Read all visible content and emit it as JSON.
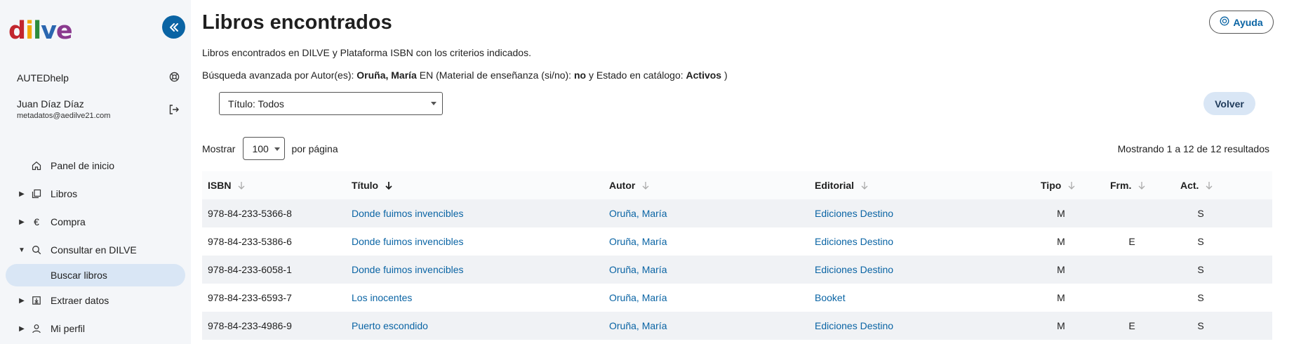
{
  "sidebar": {
    "logo": {
      "d": "d",
      "i": "i",
      "l": "l",
      "v": "v",
      "e": "e"
    },
    "org": "AUTEDhelp",
    "user_name": "Juan Díaz Díaz",
    "user_email": "metadatos@aedilve21.com",
    "nav": [
      {
        "label": "Panel de inicio",
        "icon": "home-icon"
      },
      {
        "label": "Libros",
        "icon": "books-icon",
        "caret": "▶"
      },
      {
        "label": "Compra",
        "icon": "euro-icon",
        "caret": "▶"
      },
      {
        "label": "Consultar en DILVE",
        "icon": "search-icon",
        "caret": "▼"
      },
      {
        "label": "Buscar libros"
      },
      {
        "label": "Extraer datos",
        "icon": "download-icon",
        "caret": "▶"
      },
      {
        "label": "Mi perfil",
        "icon": "user-icon",
        "caret": "▶"
      }
    ]
  },
  "header": {
    "title": "Libros encontrados",
    "help_label": "Ayuda"
  },
  "search": {
    "description": "Libros encontrados en DILVE y Plataforma ISBN con los criterios indicados.",
    "criteria_prefix": "Búsqueda avanzada por Autor(es): ",
    "criteria_author": "Oruña, María",
    "criteria_mid1": " EN (Material de enseñanza (si/no): ",
    "criteria_material": "no",
    "criteria_mid2": " y Estado en catálogo: ",
    "criteria_status": "Activos",
    "criteria_suffix": " )",
    "title_filter": "Título: Todos",
    "back_label": "Volver"
  },
  "pagination": {
    "show_label": "Mostrar",
    "per_page": "100",
    "per_page_suffix": "por página",
    "results_text": "Mostrando 1 a 12 de 12 resultados"
  },
  "table": {
    "columns": [
      "ISBN",
      "Título",
      "Autor",
      "Editorial",
      "Tipo",
      "Frm.",
      "Act."
    ],
    "rows": [
      {
        "isbn": "978-84-233-5366-8",
        "title": "Donde fuimos invencibles",
        "author": "Oruña, María",
        "publisher": "Ediciones Destino",
        "type": "M",
        "frm": "",
        "act": "S"
      },
      {
        "isbn": "978-84-233-5386-6",
        "title": "Donde fuimos invencibles",
        "author": "Oruña, María",
        "publisher": "Ediciones Destino",
        "type": "M",
        "frm": "E",
        "act": "S"
      },
      {
        "isbn": "978-84-233-6058-1",
        "title": "Donde fuimos invencibles",
        "author": "Oruña, María",
        "publisher": "Ediciones Destino",
        "type": "M",
        "frm": "",
        "act": "S"
      },
      {
        "isbn": "978-84-233-6593-7",
        "title": "Los inocentes",
        "author": "Oruña, María",
        "publisher": "Booket",
        "type": "M",
        "frm": "",
        "act": "S"
      },
      {
        "isbn": "978-84-233-4986-9",
        "title": "Puerto escondido",
        "author": "Oruña, María",
        "publisher": "Ediciones Destino",
        "type": "M",
        "frm": "E",
        "act": "S"
      }
    ]
  },
  "colors": {
    "accent": "#0a64a4",
    "selected_nav": "#d9e6f5",
    "row_alt": "#f0f2f5"
  }
}
